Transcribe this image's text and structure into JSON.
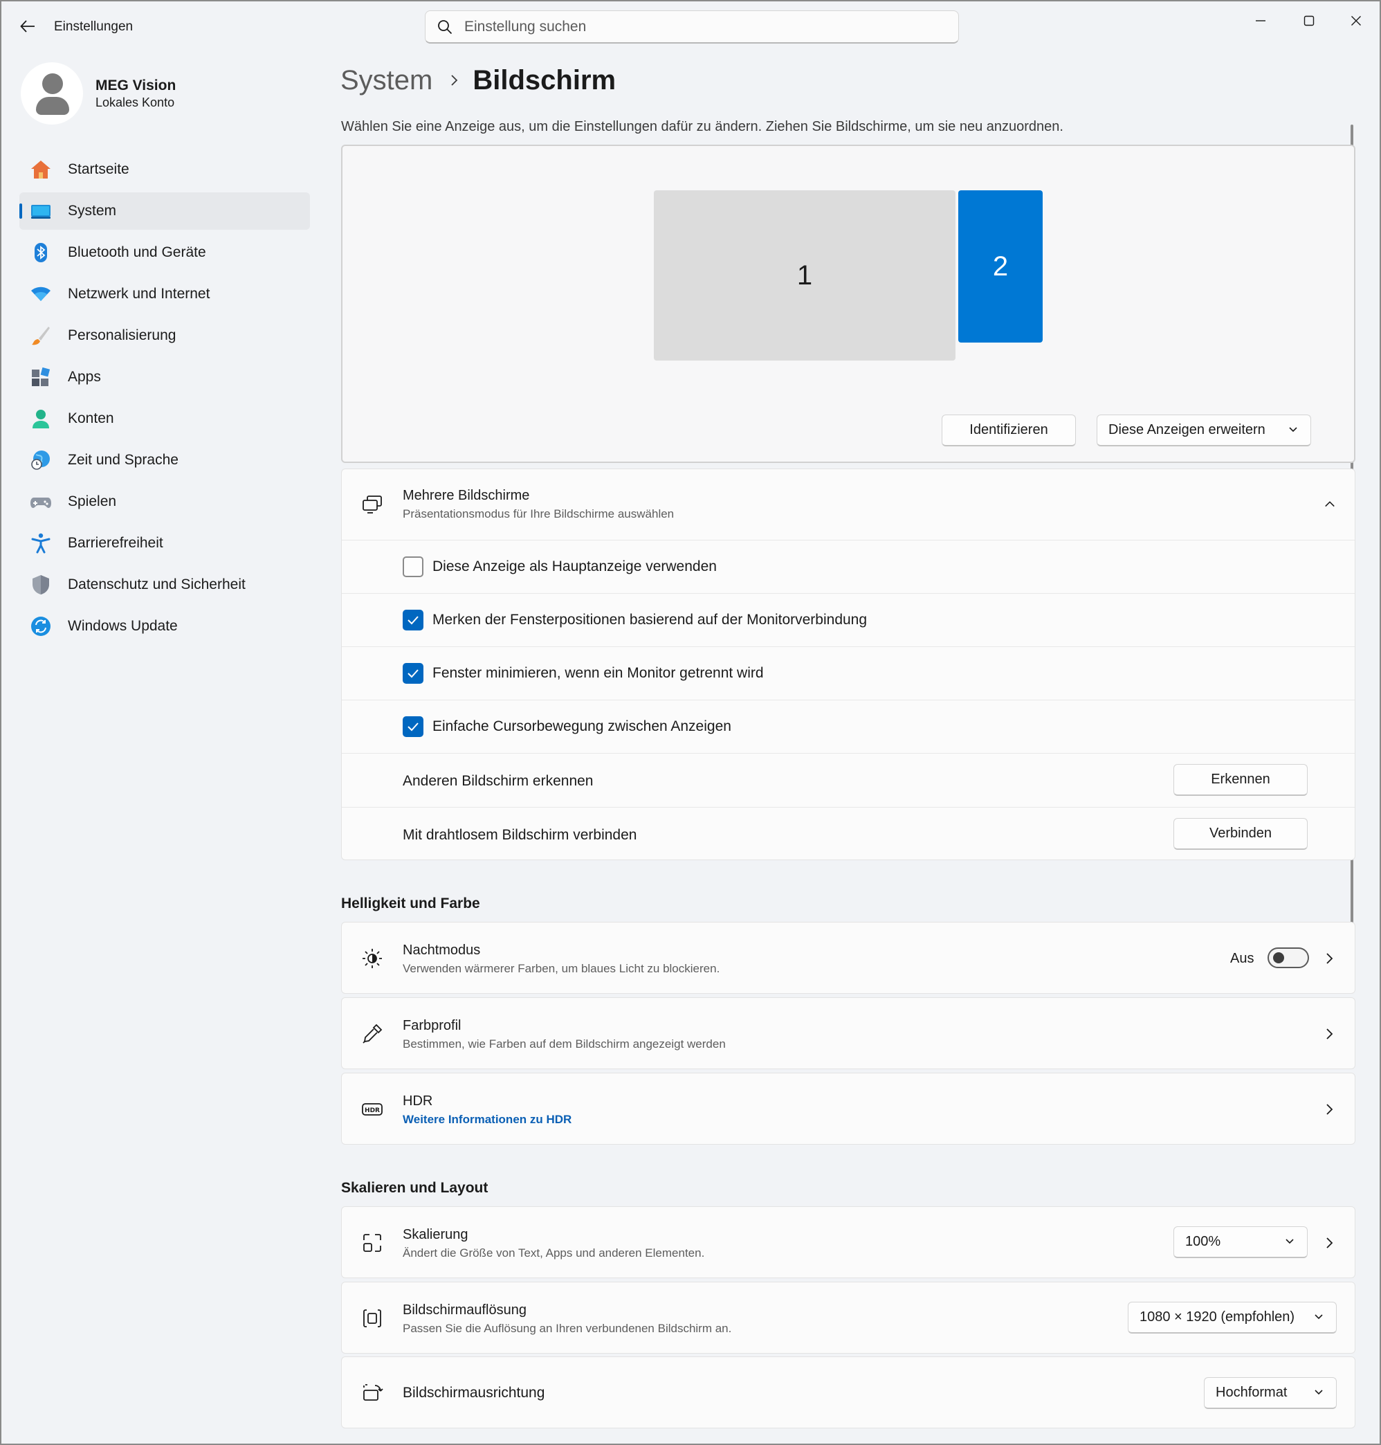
{
  "window": {
    "title": "Einstellungen"
  },
  "search": {
    "placeholder": "Einstellung suchen"
  },
  "profile": {
    "name": "MEG Vision",
    "account": "Lokales Konto"
  },
  "sidebar": {
    "items": [
      {
        "label": "Startseite",
        "icon": "home-icon"
      },
      {
        "label": "System",
        "icon": "system-monitor-icon",
        "active": true
      },
      {
        "label": "Bluetooth und Geräte",
        "icon": "bluetooth-icon"
      },
      {
        "label": "Netzwerk und Internet",
        "icon": "wifi-icon"
      },
      {
        "label": "Personalisierung",
        "icon": "brush-icon"
      },
      {
        "label": "Apps",
        "icon": "apps-icon"
      },
      {
        "label": "Konten",
        "icon": "account-icon"
      },
      {
        "label": "Zeit und Sprache",
        "icon": "globe-clock-icon"
      },
      {
        "label": "Spielen",
        "icon": "gamepad-icon"
      },
      {
        "label": "Barrierefreiheit",
        "icon": "accessibility-icon"
      },
      {
        "label": "Datenschutz und Sicherheit",
        "icon": "shield-icon"
      },
      {
        "label": "Windows Update",
        "icon": "update-icon"
      }
    ]
  },
  "header": {
    "parent": "System",
    "current": "Bildschirm"
  },
  "instruction": "Wählen Sie eine Anzeige aus, um die Einstellungen dafür zu ändern. Ziehen Sie Bildschirme, um sie neu anzuordnen.",
  "arrangement": {
    "monitor1": "1",
    "monitor2": "2",
    "identify_label": "Identifizieren",
    "mode_value": "Diese Anzeigen erweitern"
  },
  "multi": {
    "title": "Mehrere Bildschirme",
    "subtitle": "Präsentationsmodus für Ihre Bildschirme auswählen",
    "options": [
      {
        "label": "Diese Anzeige als Hauptanzeige verwenden",
        "checked": false
      },
      {
        "label": "Merken der Fensterpositionen basierend auf der Monitorverbindung",
        "checked": true
      },
      {
        "label": "Fenster minimieren, wenn ein Monitor getrennt wird",
        "checked": true
      },
      {
        "label": "Einfache Cursorbewegung zwischen Anzeigen",
        "checked": true
      }
    ],
    "detect_label": "Anderen Bildschirm erkennen",
    "detect_button": "Erkennen",
    "wireless_label": "Mit drahtlosem Bildschirm verbinden",
    "wireless_button": "Verbinden"
  },
  "brightness": {
    "section": "Helligkeit und Farbe",
    "night": {
      "title": "Nachtmodus",
      "subtitle": "Verwenden wärmerer Farben, um blaues Licht zu blockieren.",
      "state": "Aus",
      "on": false
    },
    "profile": {
      "title": "Farbprofil",
      "subtitle": "Bestimmen, wie Farben auf dem Bildschirm angezeigt werden"
    },
    "hdr": {
      "title": "HDR",
      "link": "Weitere Informationen zu HDR"
    }
  },
  "layout": {
    "section": "Skalieren und Layout",
    "scale": {
      "title": "Skalierung",
      "subtitle": "Ändert die Größe von Text, Apps und anderen Elementen.",
      "value": "100%"
    },
    "resolution": {
      "title": "Bildschirmauflösung",
      "subtitle": "Passen Sie die Auflösung an Ihren verbundenen Bildschirm an.",
      "value": "1080 × 1920 (empfohlen)"
    },
    "orientation": {
      "title": "Bildschirmausrichtung",
      "value": "Hochformat"
    }
  },
  "colors": {
    "accent": "#0067c0",
    "monitor_selected": "#0078d4",
    "link": "#0a5fb4"
  }
}
